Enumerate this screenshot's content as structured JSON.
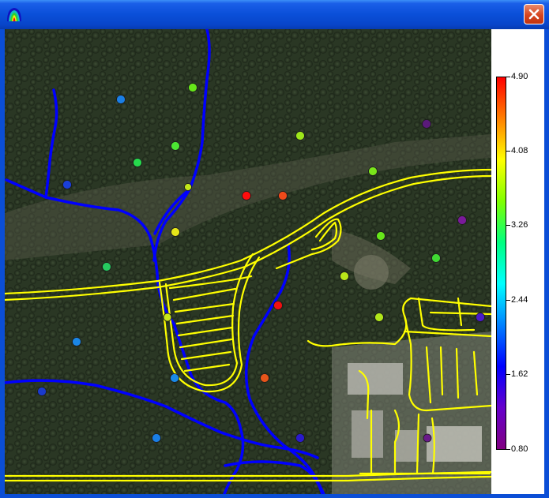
{
  "window": {
    "title": "",
    "app_icon": "contour-map-icon",
    "close_icon": "close-icon"
  },
  "colors": {
    "titlebar": "#0a4fd8",
    "road": "#ffff00",
    "stream": "#0000ff",
    "terrain": "#33412d"
  },
  "legend": {
    "labels": [
      "4.90",
      "4.08",
      "3.26",
      "2.44",
      "1.62",
      "0.80"
    ],
    "min": 0.8,
    "max": 4.9,
    "colormap": [
      "#ff0000",
      "#ff8000",
      "#ffff00",
      "#80ff00",
      "#00ff80",
      "#00ffff",
      "#0080ff",
      "#0000ff",
      "#6600cc",
      "#800080"
    ]
  },
  "stations": [
    {
      "value": 1.9,
      "color": "#1a7fe6"
    },
    {
      "value": 2.9,
      "color": "#66e619"
    },
    {
      "value": 2.8,
      "color": "#4ce633"
    },
    {
      "value": 2.6,
      "color": "#26d94c"
    },
    {
      "value": 1.4,
      "color": "#1a3fd9"
    },
    {
      "value": 3.3,
      "color": "#e6e619"
    },
    {
      "value": 3.1,
      "color": "#c2e61a"
    },
    {
      "value": 2.3,
      "color": "#26c95f"
    },
    {
      "value": 4.9,
      "color": "#ff0d0d"
    },
    {
      "value": 4.5,
      "color": "#f04a1a"
    },
    {
      "value": 3.0,
      "color": "#9de61a"
    },
    {
      "value": 2.9,
      "color": "#7ae61a"
    },
    {
      "value": 1.1,
      "color": "#5a1a7a"
    },
    {
      "value": 1.2,
      "color": "#7a1a9a"
    },
    {
      "value": 2.9,
      "color": "#66e61a"
    },
    {
      "value": 2.6,
      "color": "#40d933"
    },
    {
      "value": 3.1,
      "color": "#b8e61a"
    },
    {
      "value": 4.8,
      "color": "#f01010"
    },
    {
      "value": 3.2,
      "color": "#c8e61a"
    },
    {
      "value": 3.1,
      "color": "#b0e61a"
    },
    {
      "value": 1.3,
      "color": "#4a1acc"
    },
    {
      "value": 1.8,
      "color": "#1a86e6"
    },
    {
      "value": 1.7,
      "color": "#1a8ae6"
    },
    {
      "value": 4.4,
      "color": "#e6551a"
    },
    {
      "value": 1.5,
      "color": "#1a3acc"
    },
    {
      "value": 1.8,
      "color": "#1a7fe6"
    },
    {
      "value": 1.3,
      "color": "#2a1acc"
    },
    {
      "value": 1.1,
      "color": "#6a1a8a"
    }
  ]
}
